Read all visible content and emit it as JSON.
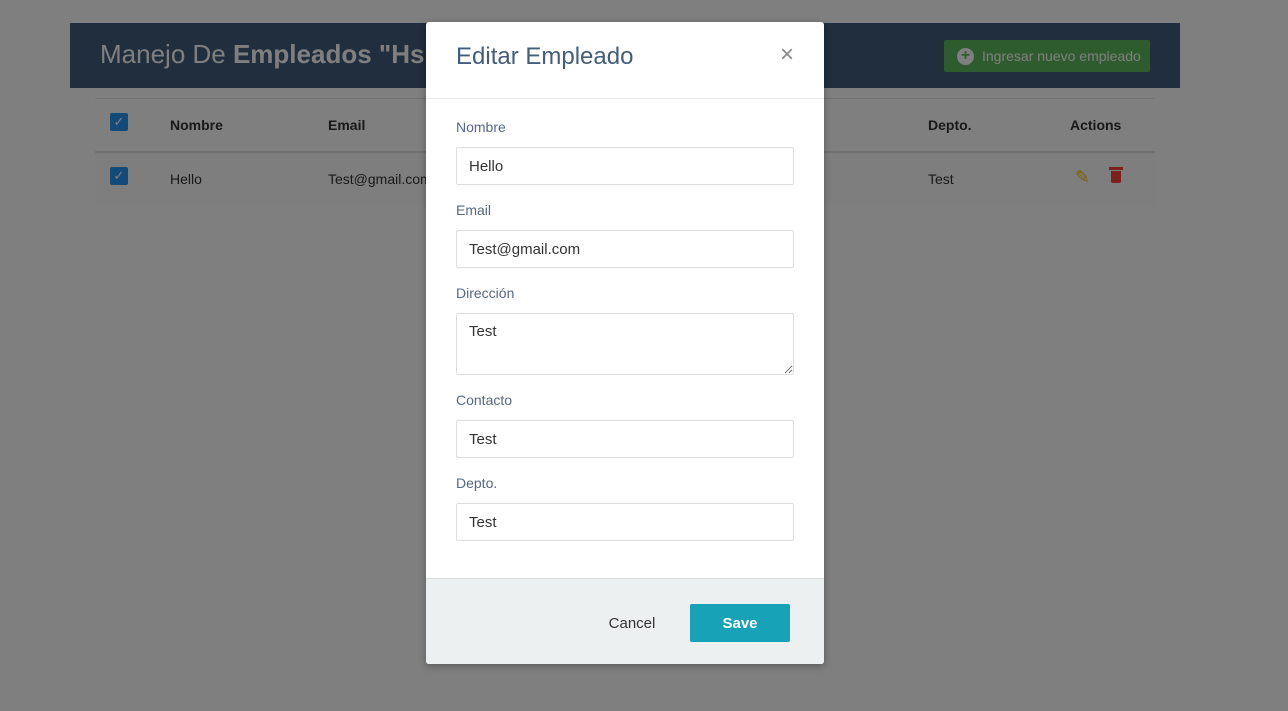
{
  "page": {
    "title_prefix": "Manejo De ",
    "title_bold": "Empleados \"Hsha",
    "add_button_label": "Ingresar nuevo empleado"
  },
  "table": {
    "headers": [
      "Nombre",
      "Email",
      "Depto.",
      "Actions"
    ],
    "rows": [
      {
        "nombre": "Hello",
        "email": "Test@gmail.com",
        "depto": "Test",
        "checked": true
      }
    ]
  },
  "modal": {
    "title": "Editar Empleado",
    "close_symbol": "×",
    "fields": [
      {
        "label": "Nombre",
        "value": "Hello"
      },
      {
        "label": "Email",
        "value": "Test@gmail.com"
      },
      {
        "label": "Dirección",
        "value": "Test"
      },
      {
        "label": "Contacto",
        "value": "Test"
      },
      {
        "label": "Depto.",
        "value": "Test"
      }
    ],
    "cancel_label": "Cancel",
    "save_label": "Save"
  },
  "colors": {
    "header_bg": "#435d7d",
    "add_button": "#5cb85c",
    "save_button": "#17a2b8",
    "checkbox": "#2196f3",
    "edit_icon": "#ffc107",
    "delete_icon": "#f44336"
  },
  "icons": [
    "plus-circle-icon",
    "check-icon",
    "pencil-icon",
    "trash-icon",
    "close-icon"
  ]
}
